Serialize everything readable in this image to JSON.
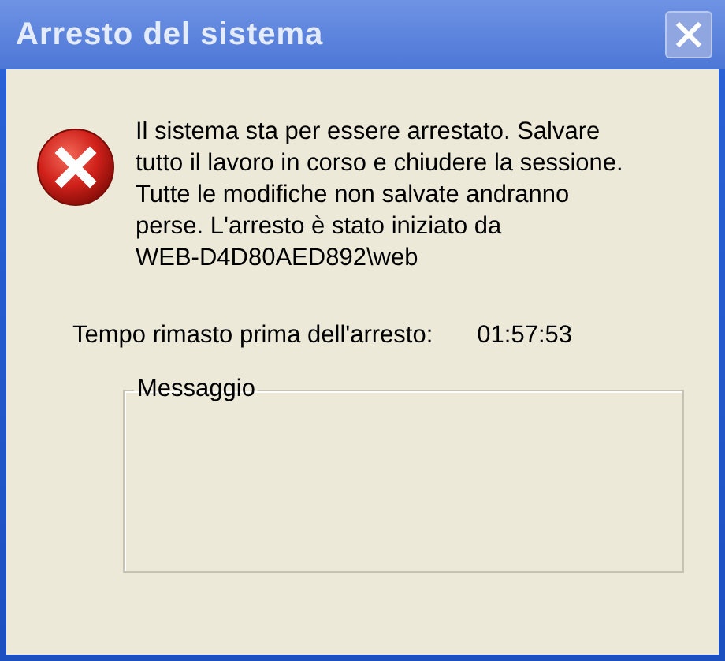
{
  "window": {
    "title": "Arresto del sistema",
    "close_button": {
      "disabled": true
    }
  },
  "message": "Il sistema sta per essere arrestato. Salvare\ntutto il lavoro in corso e chiudere la sessione.\nTutte le modifiche non salvate andranno\nperse. L'arresto è stato iniziato da\nWEB-D4D80AED892\\web",
  "countdown": {
    "label": "Tempo rimasto prima dell'arresto:",
    "value": "01:57:53"
  },
  "message_group": {
    "label": "Messaggio"
  }
}
